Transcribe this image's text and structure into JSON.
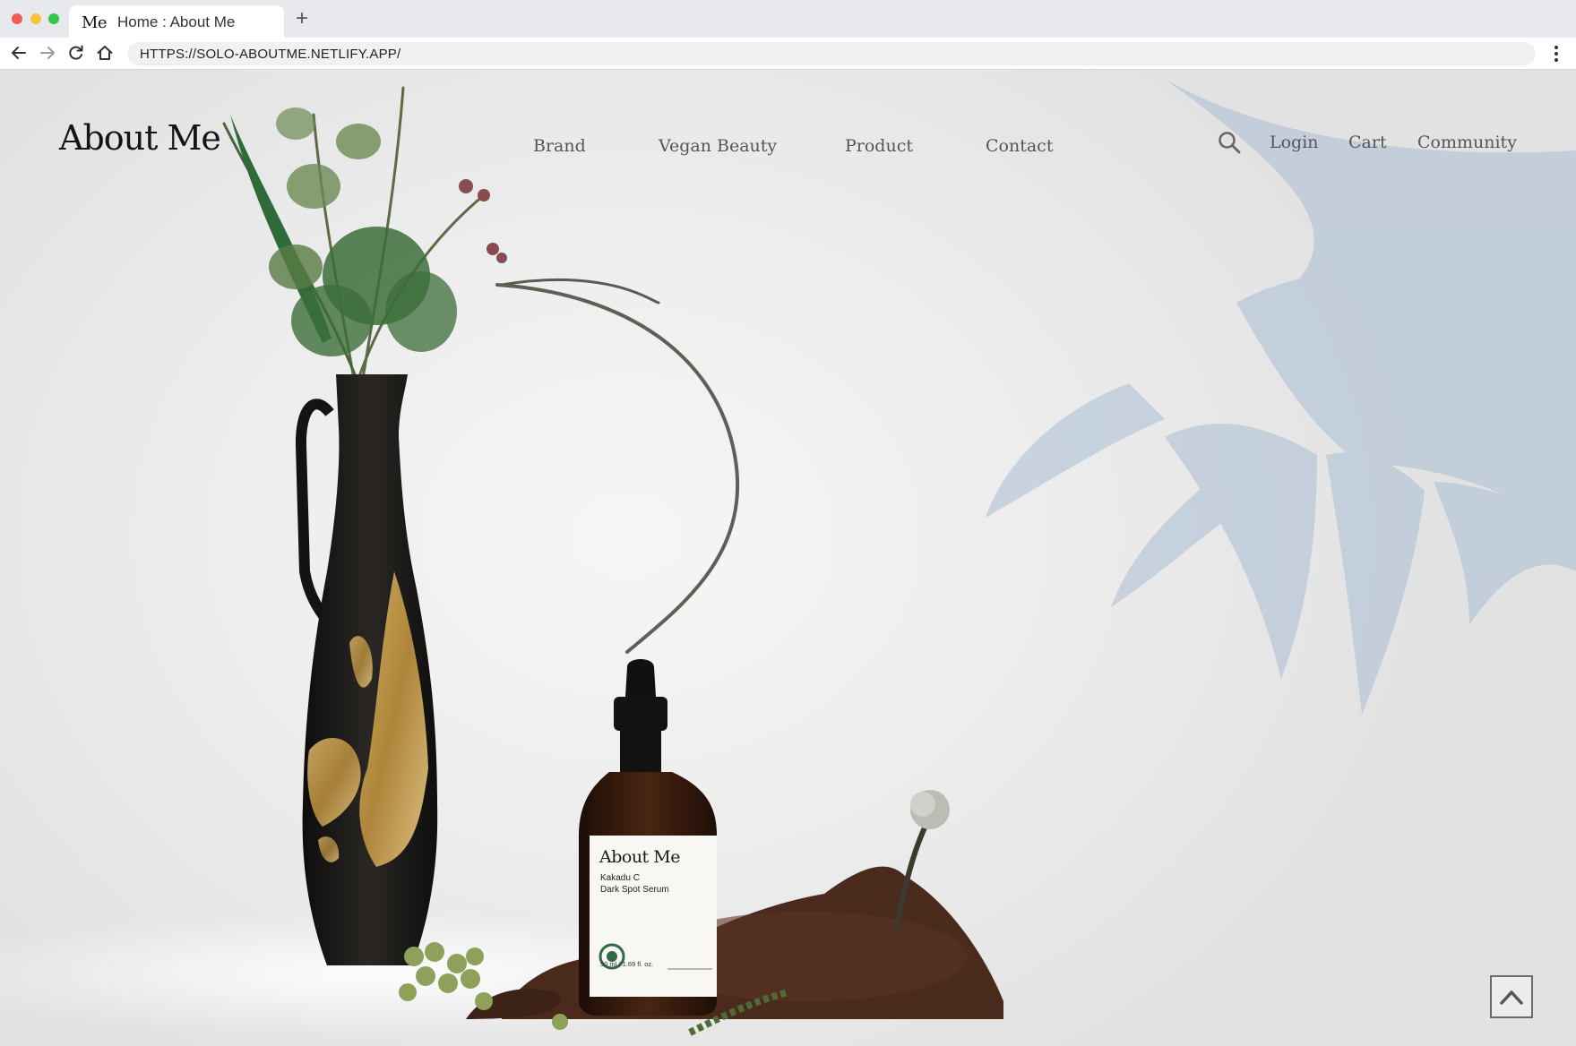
{
  "browser": {
    "tab": {
      "favicon_text": "Me",
      "title": "Home : About Me"
    },
    "new_tab_label": "+",
    "url": "HTTPS://SOLO-ABOUTME.NETLIFY.APP/"
  },
  "header": {
    "logo": "About Me",
    "nav": [
      {
        "label": "Brand"
      },
      {
        "label": "Vegan Beauty"
      },
      {
        "label": "Product"
      },
      {
        "label": "Contact"
      }
    ],
    "utility": [
      {
        "label": "Login"
      },
      {
        "label": "Cart"
      },
      {
        "label": "Community"
      }
    ]
  },
  "product": {
    "logo": "About Me",
    "name_line1": "Kakadu C",
    "name_line2": "Dark Spot Serum",
    "volume": "50 ml / 1.69 fl. oz."
  },
  "icons": {
    "search": "search-icon",
    "scroll_top": "chevron-up-icon",
    "back": "arrow-left-icon",
    "forward": "arrow-right-icon",
    "reload": "reload-icon",
    "home": "home-icon",
    "menu": "kebab-menu-icon"
  },
  "colors": {
    "nav_text": "#555555",
    "logo_text": "#141414",
    "background": "#ececec",
    "shadow_palm": "#a9bed3"
  }
}
